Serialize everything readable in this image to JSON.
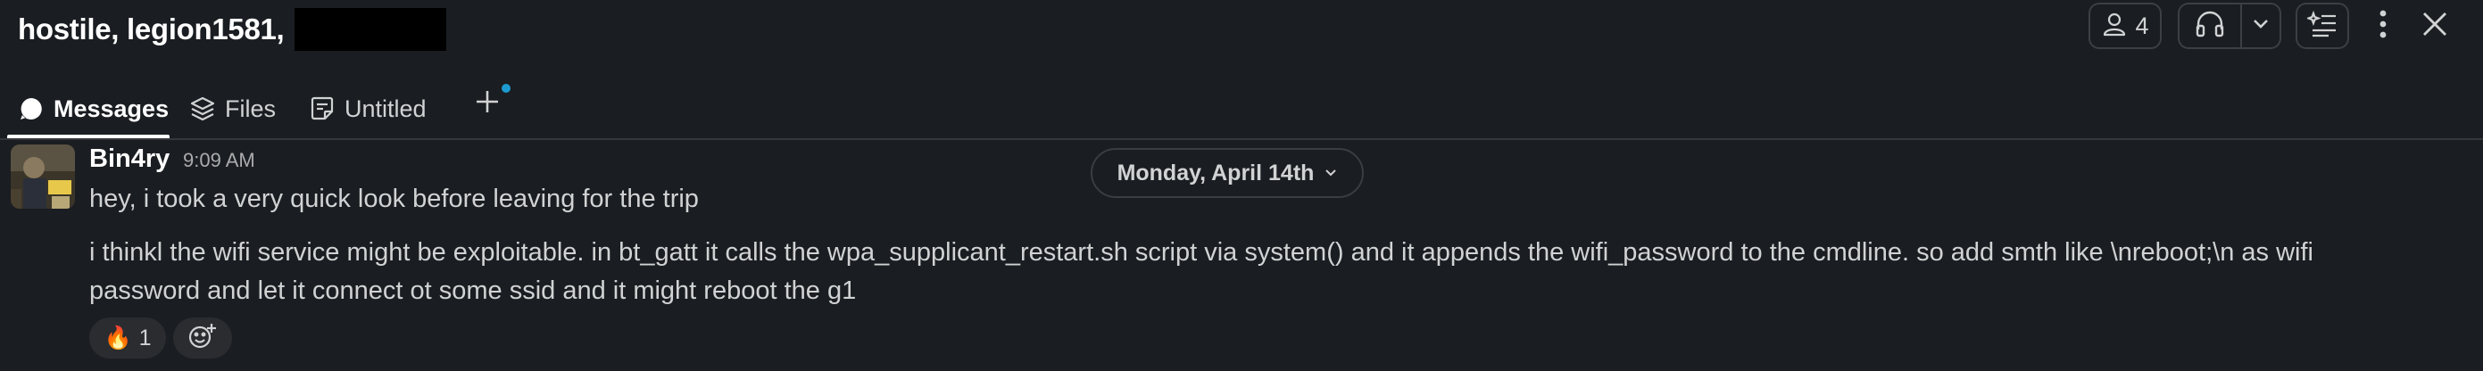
{
  "header": {
    "title": "hostile, legion1581,",
    "members_count": "4",
    "icons": {
      "members": "person-icon",
      "huddle": "headphones-icon",
      "huddle_menu": "chevron-down-icon",
      "canvas": "canvas-sparkle-icon",
      "more": "kebab-menu-icon",
      "close": "close-icon"
    }
  },
  "tabs": [
    {
      "label": "Messages",
      "icon": "message-bubble-icon",
      "active": true
    },
    {
      "label": "Files",
      "icon": "layers-icon",
      "active": false
    },
    {
      "label": "Untitled",
      "icon": "canvas-doc-icon",
      "active": false
    }
  ],
  "date_divider": {
    "label": "Monday, April 14th"
  },
  "message": {
    "sender": "Bin4ry",
    "time": "9:09 AM",
    "lines": [
      "hey, i took a very quick look before leaving for the trip",
      "i thinkl the wifi service might be exploitable. in bt_gatt it calls the wpa_supplicant_restart.sh script via system() and it appends the wifi_password to the cmdline. so add smth like \\nreboot;\\n as wifi",
      "password and let it connect ot some ssid and it might reboot the g1"
    ],
    "reaction": {
      "emoji": "🔥",
      "count": "1"
    }
  },
  "colors": {
    "background": "#1a1d21",
    "text": "#d1d2d3",
    "accent_dot": "#1d9bd1"
  }
}
